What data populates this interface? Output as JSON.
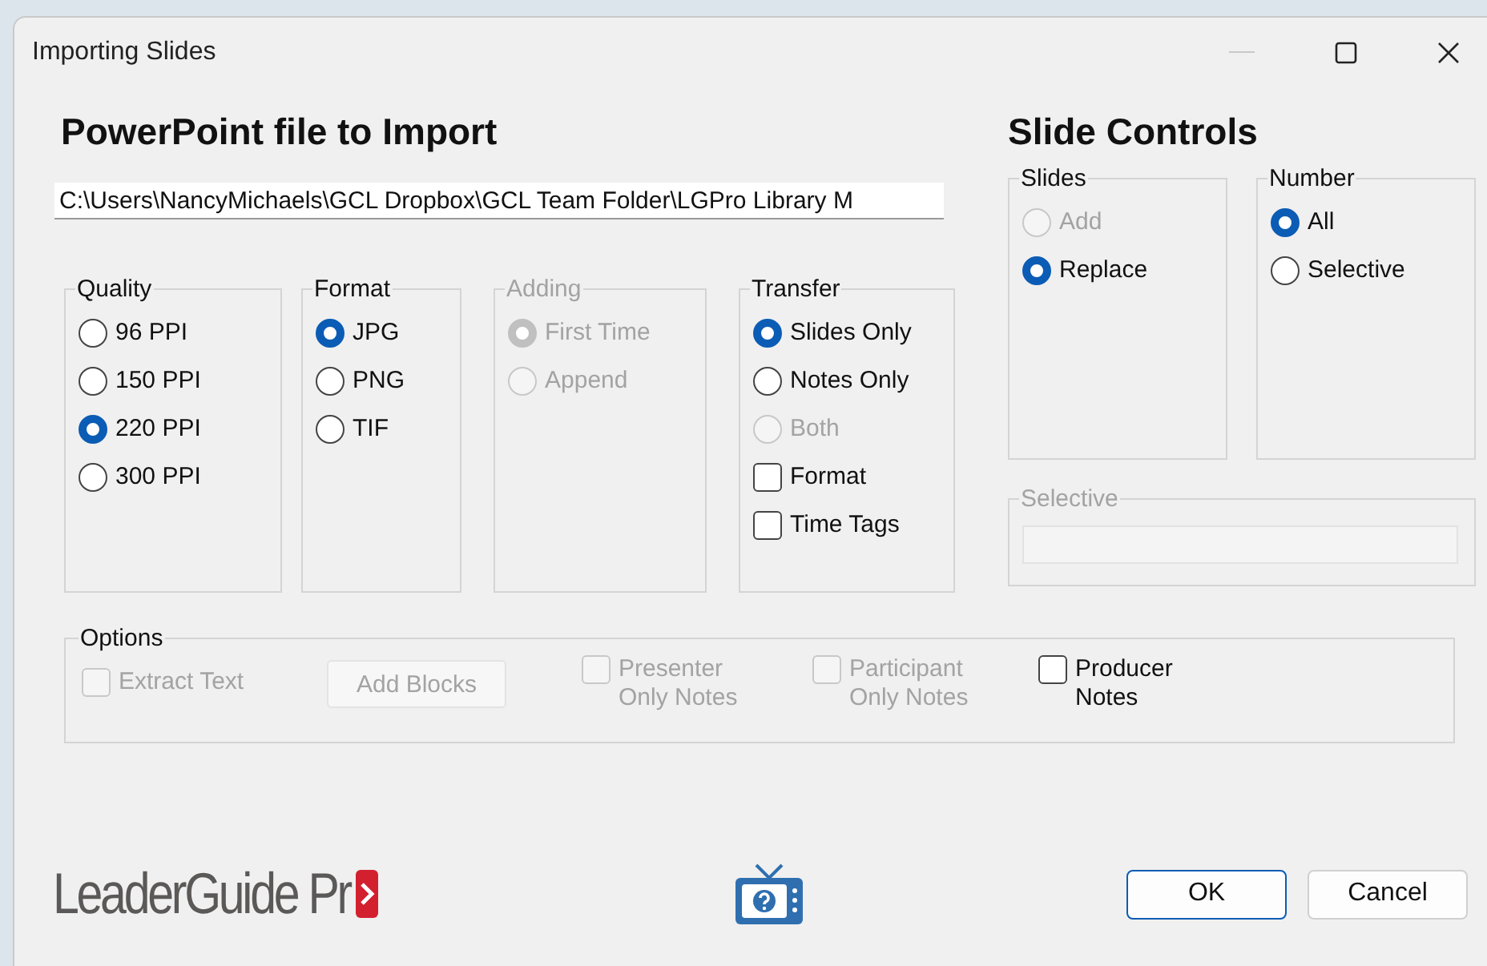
{
  "window": {
    "title": "Importing Slides"
  },
  "file_section": {
    "heading": "PowerPoint file to Import",
    "path": "C:\\Users\\NancyMichaels\\GCL Dropbox\\GCL Team Folder\\LGPro Library M"
  },
  "left_groups": [
    {
      "title": "Quality",
      "disabled": false,
      "items": [
        {
          "kind": "radio",
          "label": "96 PPI",
          "selected": false,
          "disabled": false
        },
        {
          "kind": "radio",
          "label": "150 PPI",
          "selected": false,
          "disabled": false
        },
        {
          "kind": "radio",
          "label": "220 PPI",
          "selected": true,
          "disabled": false
        },
        {
          "kind": "radio",
          "label": "300 PPI",
          "selected": false,
          "disabled": false
        }
      ]
    },
    {
      "title": "Format",
      "disabled": false,
      "items": [
        {
          "kind": "radio",
          "label": "JPG",
          "selected": true,
          "disabled": false
        },
        {
          "kind": "radio",
          "label": "PNG",
          "selected": false,
          "disabled": false
        },
        {
          "kind": "radio",
          "label": "TIF",
          "selected": false,
          "disabled": false
        }
      ]
    },
    {
      "title": "Adding",
      "disabled": true,
      "items": [
        {
          "kind": "radio",
          "label": "First Time",
          "selected": true,
          "disabled": true
        },
        {
          "kind": "radio",
          "label": "Append",
          "selected": false,
          "disabled": true
        }
      ]
    },
    {
      "title": "Transfer",
      "disabled": false,
      "items": [
        {
          "kind": "radio",
          "label": "Slides Only",
          "selected": true,
          "disabled": false
        },
        {
          "kind": "radio",
          "label": "Notes Only",
          "selected": false,
          "disabled": false
        },
        {
          "kind": "radio",
          "label": "Both",
          "selected": false,
          "disabled": true
        },
        {
          "kind": "checkbox",
          "label": "Format",
          "checked": false,
          "disabled": false
        },
        {
          "kind": "checkbox",
          "label": "Time Tags",
          "checked": false,
          "disabled": false
        }
      ]
    }
  ],
  "slide_controls": {
    "heading": "Slide Controls",
    "groups": [
      {
        "title": "Slides",
        "disabled": false,
        "items": [
          {
            "kind": "radio",
            "label": "Add",
            "selected": false,
            "disabled": true
          },
          {
            "kind": "radio",
            "label": "Replace",
            "selected": true,
            "disabled": false
          }
        ]
      },
      {
        "title": "Number",
        "disabled": false,
        "items": [
          {
            "kind": "radio",
            "label": "All",
            "selected": true,
            "disabled": false
          },
          {
            "kind": "radio",
            "label": "Selective",
            "selected": false,
            "disabled": false
          }
        ]
      }
    ],
    "selective": {
      "title": "Selective",
      "disabled": true
    }
  },
  "options": {
    "title": "Options",
    "items": [
      {
        "kind": "checkbox",
        "label": "Extract Text",
        "checked": false,
        "disabled": true
      },
      {
        "kind": "button",
        "label": "Add Blocks",
        "disabled": true
      },
      {
        "kind": "checkbox",
        "label": "Presenter\nOnly Notes",
        "checked": false,
        "disabled": true
      },
      {
        "kind": "checkbox",
        "label": "Participant\nOnly Notes",
        "checked": false,
        "disabled": true
      },
      {
        "kind": "checkbox",
        "label": "Producer\nNotes",
        "checked": false,
        "disabled": false
      }
    ]
  },
  "footer": {
    "logo": "LeaderGuide Pr",
    "buttons": [
      {
        "label": "OK",
        "default": true
      },
      {
        "label": "Cancel",
        "default": false
      }
    ]
  }
}
